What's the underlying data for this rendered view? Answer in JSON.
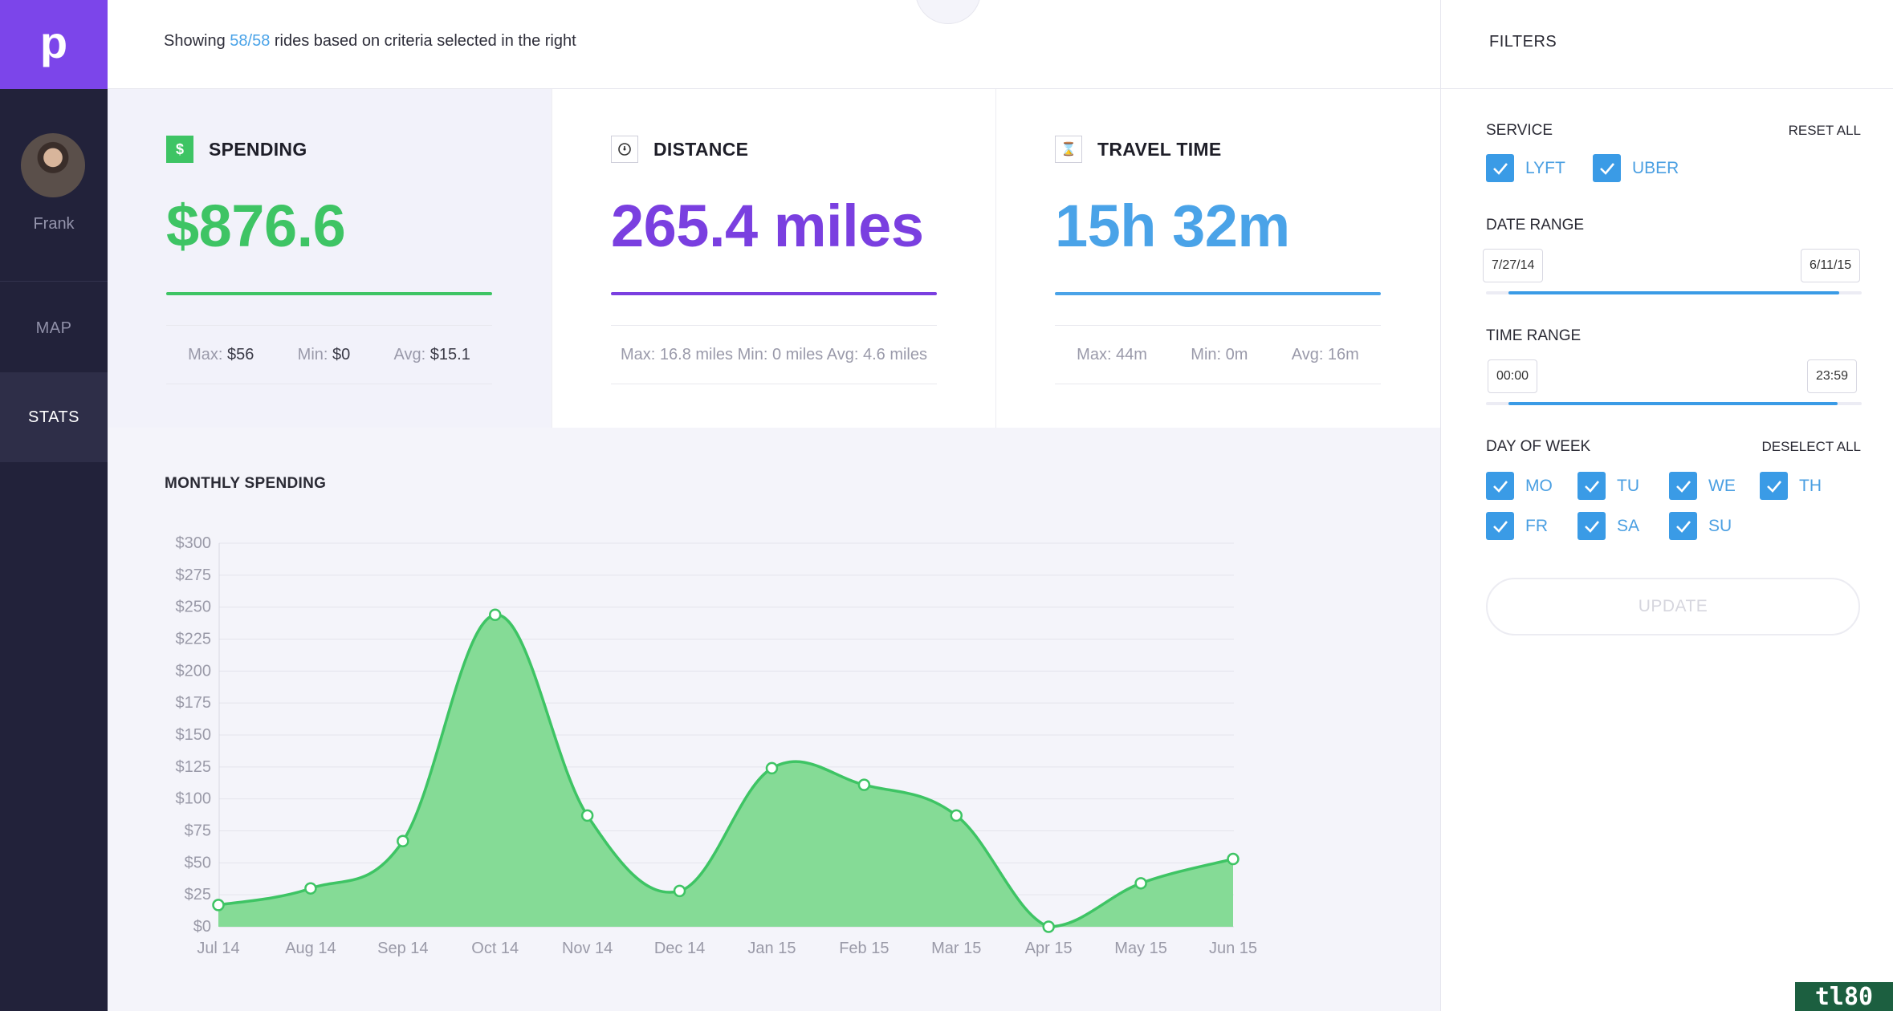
{
  "app": {
    "logo_letter": "p",
    "user_name": "Frank",
    "nav": [
      {
        "label": "MAP",
        "active": false
      },
      {
        "label": "STATS",
        "active": true
      }
    ],
    "accent_color": "#7c45ea"
  },
  "topbar": {
    "prefix": "Showing ",
    "count": "58/58",
    "suffix": " rides based on criteria selected in the right"
  },
  "cards": {
    "spending": {
      "icon": "dollar-icon",
      "icon_glyph": "$",
      "title": "SPENDING",
      "value": "$876.6",
      "color": "#3ec464",
      "max_label": "Max:",
      "max_value": "$56",
      "min_label": "Min:",
      "min_value": "$0",
      "avg_label": "Avg:",
      "avg_value": "$15.1"
    },
    "distance": {
      "icon": "speedometer-icon",
      "title": "DISTANCE",
      "value": "265.4 miles",
      "color": "#7a3fe0",
      "summary": "Max: 16.8 miles Min: 0 miles Avg: 4.6 miles"
    },
    "travel_time": {
      "icon": "hourglass-icon",
      "icon_glyph": "⌛",
      "title": "TRAVEL TIME",
      "value": "15h 32m",
      "color": "#4aa3e8",
      "max": "Max: 44m",
      "min": "Min: 0m",
      "avg": "Avg: 16m"
    }
  },
  "chart_data": {
    "type": "area",
    "title": "MONTHLY SPENDING",
    "xlabel": "",
    "ylabel": "",
    "categories": [
      "Jul 14",
      "Aug 14",
      "Sep 14",
      "Oct 14",
      "Nov 14",
      "Dec 14",
      "Jan 15",
      "Feb 15",
      "Mar 15",
      "Apr 15",
      "May 15",
      "Jun 15"
    ],
    "values": [
      17,
      30,
      67,
      244,
      87,
      28,
      124,
      111,
      87,
      0,
      34,
      53
    ],
    "ylim": [
      0,
      300
    ],
    "y_ticks": [
      0,
      25,
      50,
      75,
      100,
      125,
      150,
      175,
      200,
      225,
      250,
      275,
      300
    ],
    "y_tick_prefix": "$",
    "grid": true,
    "color": "#3ec464",
    "fill_color": "#85db96"
  },
  "filters": {
    "title": "FILTERS",
    "service": {
      "label": "SERVICE",
      "reset_label": "RESET ALL",
      "options": [
        {
          "label": "LYFT",
          "checked": true
        },
        {
          "label": "UBER",
          "checked": true
        }
      ]
    },
    "date_range": {
      "label": "DATE RANGE",
      "start": "7/27/14",
      "end": "6/11/15",
      "fill_start_fraction": 0.06,
      "fill_end_fraction": 0.94
    },
    "time_range": {
      "label": "TIME RANGE",
      "start": "00:00",
      "end": "23:59",
      "fill_start_fraction": 0.06,
      "fill_end_fraction": 0.935
    },
    "day_of_week": {
      "label": "DAY OF WEEK",
      "deselect_label": "DESELECT ALL",
      "days": [
        {
          "label": "MO",
          "checked": true
        },
        {
          "label": "TU",
          "checked": true
        },
        {
          "label": "WE",
          "checked": true
        },
        {
          "label": "TH",
          "checked": true
        },
        {
          "label": "FR",
          "checked": true
        },
        {
          "label": "SA",
          "checked": true
        },
        {
          "label": "SU",
          "checked": true
        }
      ]
    },
    "update_label": "UPDATE"
  },
  "watermark": "tl80"
}
